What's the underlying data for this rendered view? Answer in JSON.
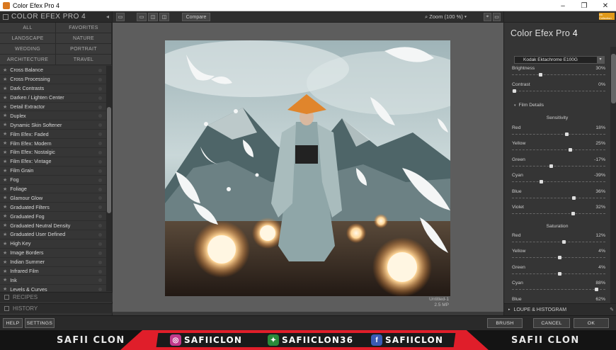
{
  "window": {
    "title": "Color Efex Pro 4",
    "controls": [
      "–",
      "❐",
      "✕"
    ]
  },
  "left_panel": {
    "header": "COLOR EFEX PRO 4",
    "categories": [
      "ALL",
      "FAVORITES",
      "LANDSCAPE",
      "NATURE",
      "WEDDING",
      "PORTRAIT",
      "ARCHITECTURE",
      "TRAVEL"
    ],
    "filters": [
      "Cross Balance",
      "Cross Processing",
      "Dark Contrasts",
      "Darken / Lighten Center",
      "Detail Extractor",
      "Duplex",
      "Dynamic Skin Softener",
      "Film Efex: Faded",
      "Film Efex: Modern",
      "Film Efex: Nostalgic",
      "Film Efex: Vintage",
      "Film Grain",
      "Fog",
      "Foliage",
      "Glamour Glow",
      "Graduated Filters",
      "Graduated Fog",
      "Graduated Neutral Density",
      "Graduated User Defined",
      "High Key",
      "Image Borders",
      "Indian Summer",
      "Infrared Film",
      "Ink",
      "Levels & Curves"
    ],
    "recipes_label": "RECIPES",
    "history_label": "HISTORY"
  },
  "toolbar": {
    "compare_label": "Compare",
    "zoom_label": "Zoom (100 %)"
  },
  "canvas": {
    "filename": "Untitled-1",
    "size": "2.5 MP"
  },
  "right_panel": {
    "brand": "Color Efex Pro",
    "brand_version": "4",
    "badge": "nik Collection",
    "preset": "Kodak Ektachrome E100G",
    "brightness": {
      "label": "Brightness",
      "value": "30%",
      "pos": 0.3
    },
    "contrast": {
      "label": "Contrast",
      "value": "0%",
      "pos": 0.02
    },
    "film_details_label": "Film Details",
    "sensitivity_label": "Sensitivity",
    "sensitivity": [
      {
        "label": "Red",
        "value": "18%",
        "pos": 0.58
      },
      {
        "label": "Yellow",
        "value": "25%",
        "pos": 0.62
      },
      {
        "label": "Green",
        "value": "-17%",
        "pos": 0.42
      },
      {
        "label": "Cyan",
        "value": "-39%",
        "pos": 0.31
      },
      {
        "label": "Blue",
        "value": "36%",
        "pos": 0.66
      },
      {
        "label": "Violet",
        "value": "32%",
        "pos": 0.65
      }
    ],
    "saturation_label": "Saturation",
    "saturation": [
      {
        "label": "Red",
        "value": "12%",
        "pos": 0.55
      },
      {
        "label": "Yellow",
        "value": "4%",
        "pos": 0.51
      },
      {
        "label": "Green",
        "value": "4%",
        "pos": 0.51
      },
      {
        "label": "Cyan",
        "value": "88%",
        "pos": 0.9
      },
      {
        "label": "Blue",
        "value": "62%",
        "pos": 0.78
      }
    ],
    "loupe_label": "LOUPE & HISTOGRAM"
  },
  "bottom": {
    "help": "HELP",
    "settings": "SETTINGS",
    "brush": "BRUSH",
    "cancel": "CANCEL",
    "ok": "OK"
  },
  "banner": {
    "name_left": "SAFII CLON",
    "instagram": "SAFIICLON",
    "other": "SAFIICLON36",
    "facebook": "SAFIICLON",
    "name_right": "SAFII CLON"
  }
}
